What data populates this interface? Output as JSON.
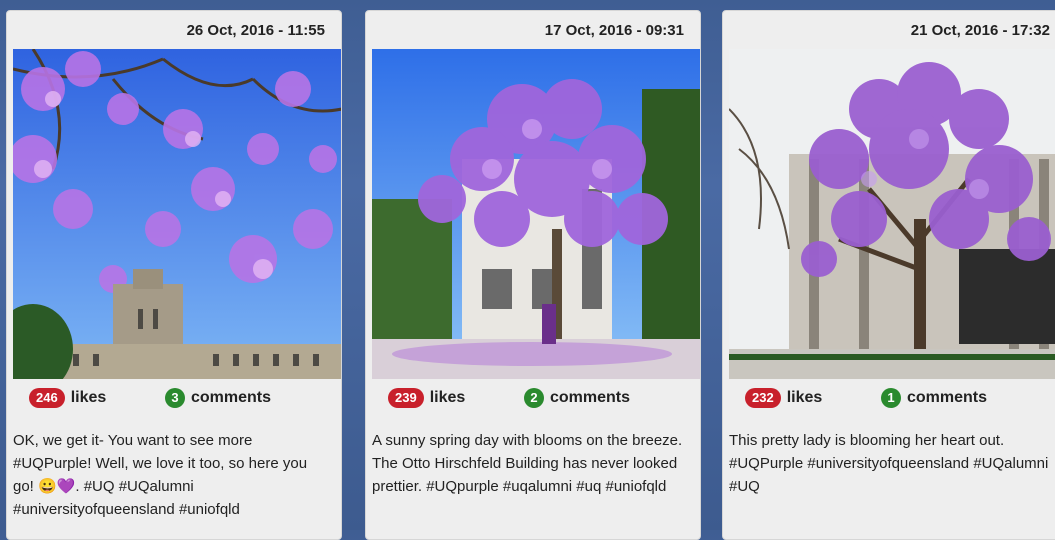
{
  "posts": [
    {
      "date": "26 Oct, 2016 - 11:55",
      "likes_count": "246",
      "likes_label": "likes",
      "comments_count": "3",
      "comments_label": "comments",
      "caption": "OK, we get it- You want to see more #UQPurple! Well, we love it too, so here you go! 😀💜. #UQ #UQalumni #universityofqueensland #uniofqld"
    },
    {
      "date": "17 Oct, 2016 - 09:31",
      "likes_count": "239",
      "likes_label": "likes",
      "comments_count": "2",
      "comments_label": "comments",
      "caption": "A sunny spring day with blooms on the breeze. The Otto Hirschfeld Building has never looked prettier. #UQpurple #uqalumni #uq #uniofqld"
    },
    {
      "date": "21 Oct, 2016 - 17:32",
      "likes_count": "232",
      "likes_label": "likes",
      "comments_count": "1",
      "comments_label": "comments",
      "caption": "This pretty lady is blooming her heart out. #UQPurple #universityofqueensland #UQalumni #UQ"
    }
  ],
  "colors": {
    "likes_badge": "#c8202b",
    "comments_badge": "#2a8a2e",
    "jacaranda": "#9a5fd0"
  }
}
